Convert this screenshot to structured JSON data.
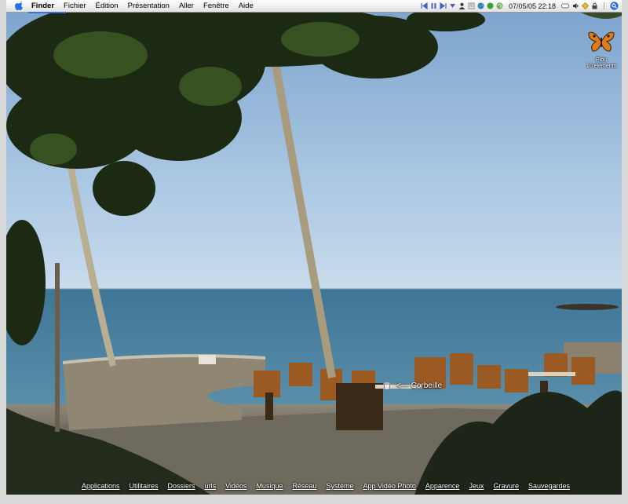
{
  "menubar": {
    "app_name": "Finder",
    "items": [
      "Fichier",
      "Édition",
      "Présentation",
      "Aller",
      "Fenêtre",
      "Aide"
    ],
    "clock": "07/05/05 22:18"
  },
  "desktop": {
    "icon": {
      "name": "Piou",
      "subtitle": "10 éléments"
    },
    "trash_label": "<--- Corbeille"
  },
  "dock": {
    "items": [
      "Applications",
      "Utilitaires",
      "Dossiers",
      "urls",
      "Vidéos",
      "Musique",
      "Réseau",
      "Système",
      "App Vidéo Photo",
      "Apparence",
      "Jeux",
      "Gravure",
      "Sauvegardes"
    ]
  },
  "colors": {
    "sky_top": "#7aa3cf",
    "sea": "#4a7c9e",
    "accent": "#3d6fd6"
  }
}
